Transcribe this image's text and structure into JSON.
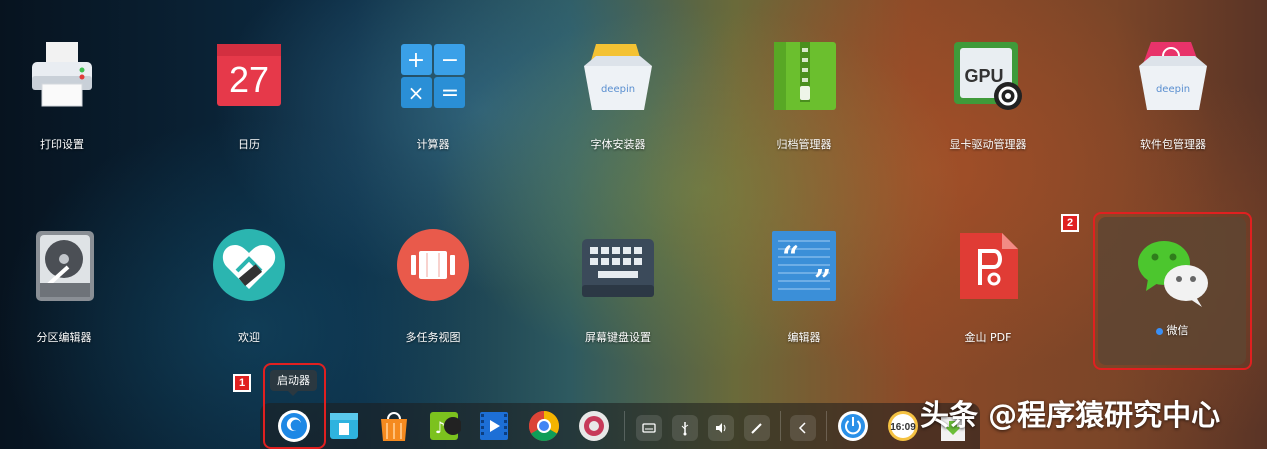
{
  "launcher": {
    "apps": [
      {
        "label": "打印设置",
        "icon": "printer-icon"
      },
      {
        "label": "日历",
        "icon": "calendar-icon",
        "day": "27"
      },
      {
        "label": "计算器",
        "icon": "calculator-icon"
      },
      {
        "label": "字体安装器",
        "icon": "font-installer-icon",
        "brand": "deepin"
      },
      {
        "label": "归档管理器",
        "icon": "archive-manager-icon"
      },
      {
        "label": "显卡驱动管理器",
        "icon": "gpu-driver-icon",
        "chip": "GPU"
      },
      {
        "label": "软件包管理器",
        "icon": "package-manager-icon",
        "brand": "deepin"
      },
      {
        "label": "分区编辑器",
        "icon": "partition-editor-icon"
      },
      {
        "label": "欢迎",
        "icon": "welcome-icon"
      },
      {
        "label": "多任务视图",
        "icon": "multitask-view-icon"
      },
      {
        "label": "屏幕键盘设置",
        "icon": "onscreen-keyboard-icon"
      },
      {
        "label": "编辑器",
        "icon": "text-editor-icon"
      },
      {
        "label": "金山 PDF",
        "icon": "kingsoft-pdf-icon"
      },
      {
        "label": "微信",
        "icon": "wechat-icon",
        "selected": true,
        "new": true
      }
    ]
  },
  "annotations": {
    "badge1": "1",
    "badge2": "2"
  },
  "dock": {
    "tooltip": "启动器",
    "items": [
      "launcher-icon",
      "file-manager-icon",
      "app-store-icon",
      "music-icon",
      "movie-icon",
      "chrome-icon",
      "settings-icon"
    ],
    "tray": [
      "keyboard-icon",
      "usb-icon",
      "volume-icon",
      "pen-icon",
      "collapse-icon"
    ],
    "clock": "16:09"
  },
  "watermark": "头条 @程序猿研究中心",
  "colors": {
    "selection_border": "#e02020",
    "new_dot": "#3a8ff5",
    "calendar_red": "#e6394a",
    "wechat_green": "#4cc62e"
  }
}
